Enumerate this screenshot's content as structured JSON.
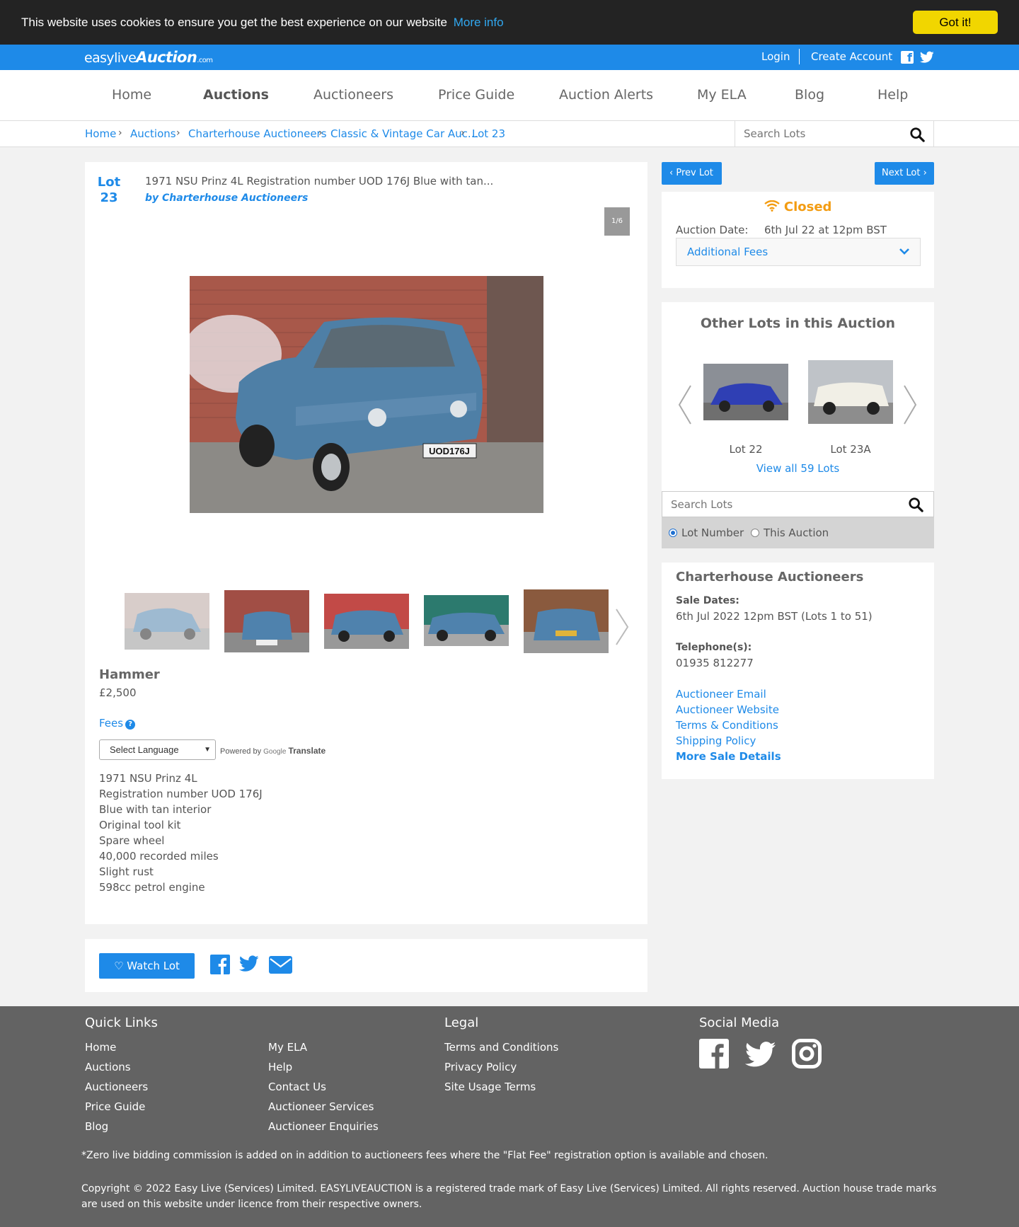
{
  "cookie": {
    "text": "This website uses cookies to ensure you get the best experience on our website",
    "more_info": "More info",
    "accept": "Got it!",
    "accept_color": "#f1d600"
  },
  "header": {
    "logo_prefix": "easylive",
    "logo_bold": "Auction",
    "logo_suffix": ".com",
    "login": "Login",
    "create_account": "Create Account",
    "brand_color": "#1e8ae8"
  },
  "nav": {
    "items": [
      "Home",
      "Auctions",
      "Auctioneers",
      "Price Guide",
      "Auction Alerts",
      "My ELA",
      "Blog",
      "Help"
    ],
    "active": "Auctions"
  },
  "breadcrumb": [
    "Home",
    "Auctions",
    "Charterhouse Auctioneers",
    "Classic & Vintage Car Auc...",
    "Lot 23"
  ],
  "search": {
    "placeholder": "Search Lots"
  },
  "lot": {
    "label": "Lot",
    "number": "23",
    "title": "1971 NSU Prinz 4L Registration number UOD 176J Blue with tan...",
    "by": "by Charterhouse Auctioneers",
    "image_counter": "1/6",
    "hammer_label": "Hammer",
    "hammer_value": "£2,500",
    "fees_label": "Fees",
    "language_select": "Select Language",
    "powered_by": "Powered by",
    "google": "Google",
    "translate": "Translate",
    "description": [
      "1971 NSU Prinz 4L",
      "Registration number UOD 176J",
      "Blue with tan interior",
      "Original tool kit",
      "Spare wheel",
      "40,000 recorded miles",
      "Slight rust",
      "598cc petrol engine"
    ],
    "watch_label": "Watch Lot"
  },
  "sidebar": {
    "prev_lot": "Prev Lot",
    "next_lot": "Next Lot",
    "status": "Closed",
    "status_color": "#f39c12",
    "auction_date_label": "Auction Date:",
    "auction_date_value": "6th Jul 22 at 12pm BST",
    "additional_fees": "Additional Fees",
    "other_lots_title": "Other Lots in this Auction",
    "other_lots": [
      {
        "label": "Lot 22"
      },
      {
        "label": "Lot 23A"
      }
    ],
    "view_all": "View all 59 Lots",
    "search_placeholder": "Search Lots",
    "radio_lot_number": "Lot Number",
    "radio_this_auction": "This Auction",
    "auctioneer": {
      "name": "Charterhouse Auctioneers",
      "sale_dates_label": "Sale Dates:",
      "sale_dates_value": "6th Jul 2022 12pm BST (Lots 1 to 51)",
      "telephone_label": "Telephone(s):",
      "telephone_value": "01935 812277",
      "links": [
        "Auctioneer Email",
        "Auctioneer Website",
        "Terms & Conditions",
        "Shipping Policy"
      ],
      "more_details": "More Sale Details"
    }
  },
  "footer": {
    "quick_links_title": "Quick Links",
    "quick_links_col1": [
      "Home",
      "Auctions",
      "Auctioneers",
      "Price Guide",
      "Blog"
    ],
    "quick_links_col2": [
      "My ELA",
      "Help",
      "Contact Us",
      "Auctioneer Services",
      "Auctioneer Enquiries"
    ],
    "legal_title": "Legal",
    "legal_links": [
      "Terms and Conditions",
      "Privacy Policy",
      "Site Usage Terms"
    ],
    "social_title": "Social Media",
    "note": "*Zero live bidding commission is added on in addition to auctioneers fees where the \"Flat Fee\" registration option is available and chosen.",
    "copyright": "Copyright © 2022 Easy Live (Services) Limited. EASYLIVEAUCTION is a registered trade mark of Easy Live (Services) Limited. All rights reserved. Auction house trade marks are used on this website under licence from their respective owners."
  }
}
